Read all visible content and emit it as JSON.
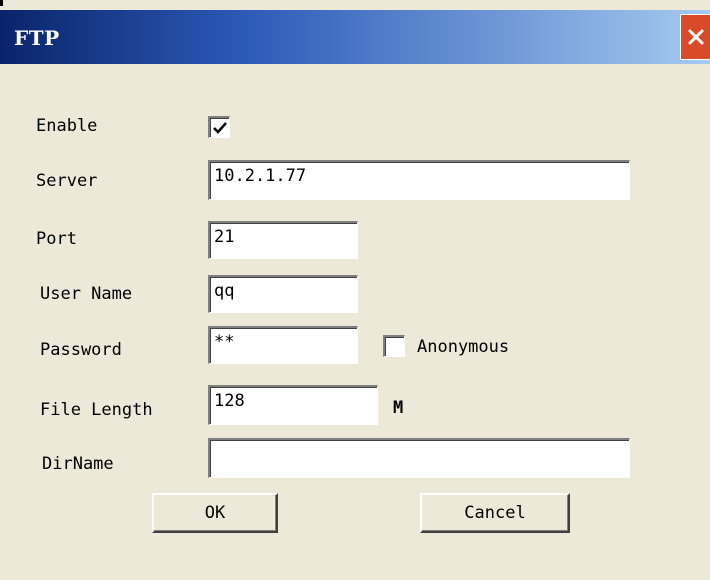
{
  "window": {
    "title": "FTP"
  },
  "form": {
    "enable": {
      "label": "Enable",
      "checked": true
    },
    "server": {
      "label": "Server",
      "value": "10.2.1.77"
    },
    "port": {
      "label": "Port",
      "value": "21"
    },
    "username": {
      "label": "User Name",
      "value": "qq"
    },
    "password": {
      "label": "Password",
      "value": "**"
    },
    "anonymous": {
      "label": "Anonymous",
      "checked": false
    },
    "file_length": {
      "label": "File Length",
      "value": "128",
      "unit": "M"
    },
    "dirname": {
      "label": "DirName",
      "value": ""
    }
  },
  "buttons": {
    "ok": "OK",
    "cancel": "Cancel"
  },
  "icons": {
    "close": "close-icon",
    "check": "checkmark-icon"
  },
  "colors": {
    "title_start": "#0a246a",
    "title_end": "#a6caf0",
    "close": "#d94a2a",
    "face": "#ece9d8"
  }
}
